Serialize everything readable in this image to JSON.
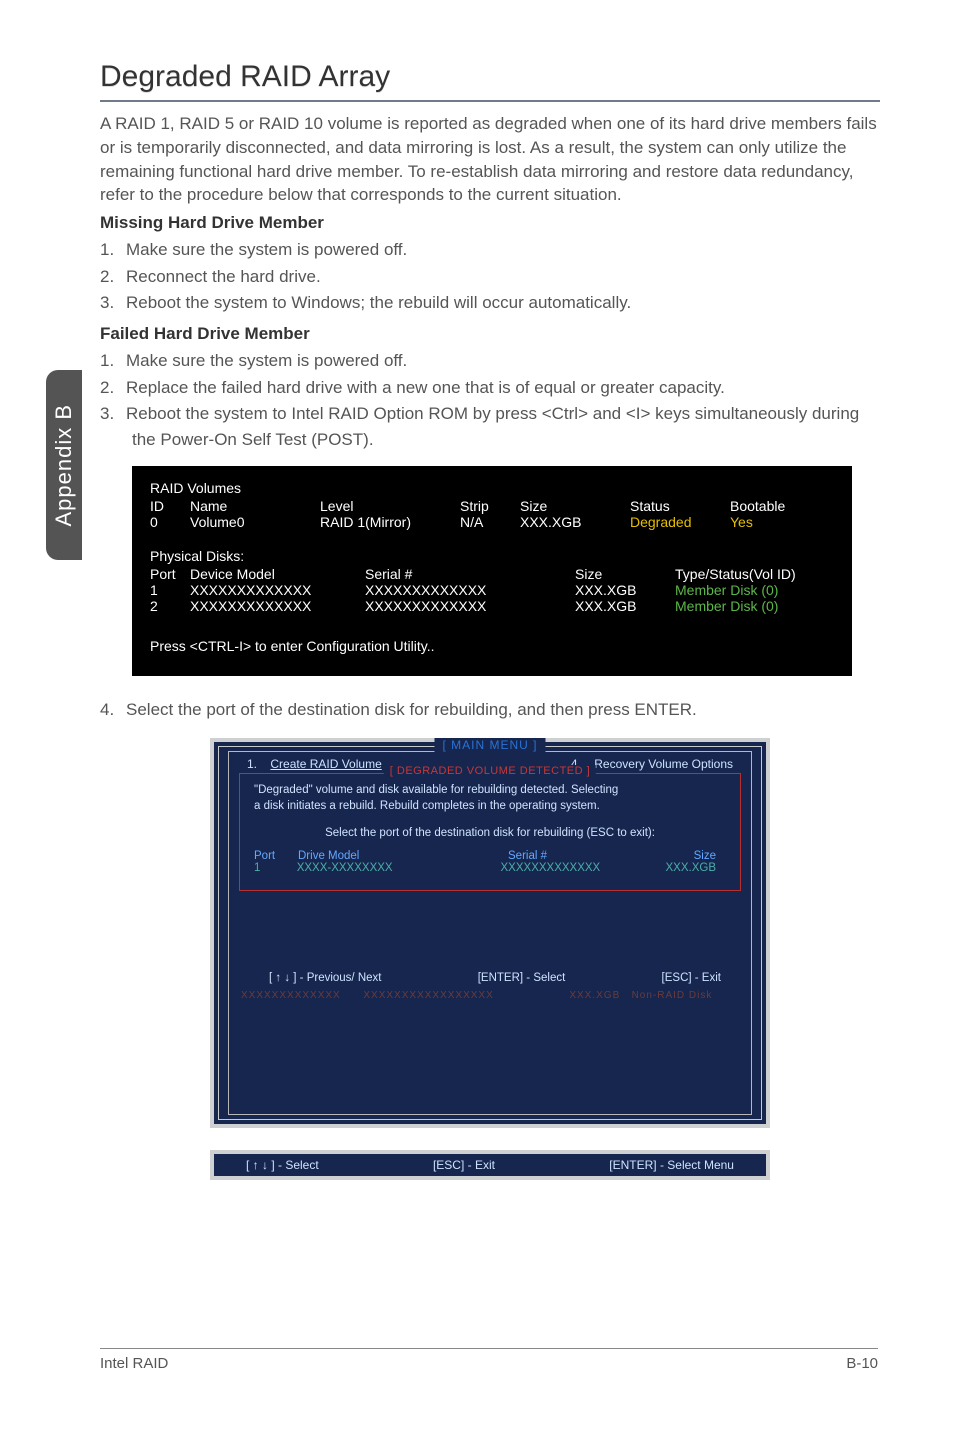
{
  "side_tab": "Appendix B",
  "title": "Degraded RAID Array",
  "intro": "A RAID 1, RAID 5 or RAID 10 volume is reported as degraded when one of its hard drive members fails or is temporarily disconnected, and data mirroring is lost. As a result, the system can only utilize the remaining functional hard drive member. To re-establish data mirroring and restore data redundancy, refer to the procedure below that corresponds to the current situation.",
  "missing": {
    "heading": "Missing Hard Drive Member",
    "items": [
      "Make sure the system is powered off.",
      "Reconnect the hard drive.",
      "Reboot the system to Windows; the rebuild will occur automatically."
    ]
  },
  "failed": {
    "heading": "Failed Hard Drive Member",
    "items": [
      "Make sure the system is powered off.",
      "Replace the failed hard drive with a new one that is of equal or greater capacity.",
      "Reboot the system to Intel RAID Option ROM by press <Ctrl> and <I> keys simultaneously during the Power-On Self Test (POST)."
    ]
  },
  "term1": {
    "raid_volumes_label": "RAID Volumes",
    "headers": {
      "id": "ID",
      "name": "Name",
      "level": "Level",
      "strip": "Strip",
      "size": "Size",
      "status": "Status",
      "bootable": "Bootable"
    },
    "row": {
      "id": "0",
      "name": "Volume0",
      "level": "RAID 1(Mirror)",
      "strip": "N/A",
      "size": "XXX.XGB",
      "status": "Degraded",
      "bootable": "Yes"
    },
    "phys_label": "Physical Disks:",
    "phys_headers": {
      "port": "Port",
      "model": "Device Model",
      "serial": "Serial #",
      "size": "Size",
      "type": "Type/Status(Vol ID)"
    },
    "phys_rows": [
      {
        "port": "1",
        "model": "XXXXXXXXXXXXX",
        "serial": "XXXXXXXXXXXXX",
        "size": "XXX.XGB",
        "type": "Member  Disk (0)"
      },
      {
        "port": "2",
        "model": "XXXXXXXXXXXXX",
        "serial": "XXXXXXXXXXXXX",
        "size": "XXX.XGB",
        "type": "Member  Disk (0)"
      }
    ],
    "footer": "Press  <CTRL-I>  to enter Configuration Utility.."
  },
  "step4": "Select the port of the destination disk for rebuilding, and then press ENTER.",
  "bios": {
    "title": "[  MAIN  MENU  ]",
    "menu_left_num": "1.",
    "menu_left": "Create  RAID  Volume",
    "menu_right_num": "4.",
    "menu_right": "Recovery Volume  Options",
    "box_title": "[  DEGRADED VOLUME DETECTED  ]",
    "msg1": "\"Degraded\" volume and disk available for rebuilding detected. Selecting",
    "msg2": "a disk initiates a rebuild. Rebuild completes in the  operating system.",
    "msg3": "Select the port of the destination disk for rebuilding (ESC to exit):",
    "hdr": {
      "port": "Port",
      "model": "Drive  Model",
      "serial": "Serial  #",
      "size": "Size"
    },
    "row": {
      "port": "1",
      "model": "XXXX-XXXXXXXX",
      "serial": "XXXXXXXXXXXXX",
      "size": "XXX.XGB"
    },
    "ctrl": {
      "prevnext": "[ ↑ ↓ ] - Previous/ Next",
      "enter": "[ENTER] - Select",
      "esc": "[ESC] - Exit"
    },
    "bottom": {
      "select": "[ ↑ ↓ ] - Select",
      "esc": "[ESC] - Exit",
      "enter": "[ENTER] - Select Menu"
    }
  },
  "footer": {
    "left": "Intel RAID",
    "right": "B-10"
  }
}
